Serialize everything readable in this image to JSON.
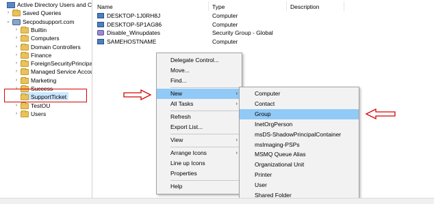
{
  "tree": {
    "items": [
      {
        "label": "Active Directory Users and Com",
        "icon": "root-icon",
        "level": 0,
        "expander": ""
      },
      {
        "label": "Saved Queries",
        "icon": "folder-icon",
        "level": 1,
        "expander": "›"
      },
      {
        "label": "Secpodsupport.com",
        "icon": "domain-icon",
        "level": 1,
        "expander": "⌄"
      },
      {
        "label": "Builtin",
        "icon": "folder-icon",
        "level": 2,
        "expander": "›"
      },
      {
        "label": "Computers",
        "icon": "folder-icon",
        "level": 2,
        "expander": "›"
      },
      {
        "label": "Domain Controllers",
        "icon": "folder-icon",
        "level": 2,
        "expander": "›"
      },
      {
        "label": "Finance",
        "icon": "folder-icon",
        "level": 2,
        "expander": "›"
      },
      {
        "label": "ForeignSecurityPrincipals",
        "icon": "folder-icon",
        "level": 2,
        "expander": "›"
      },
      {
        "label": "Managed Service Accour",
        "icon": "folder-icon",
        "level": 2,
        "expander": "›"
      },
      {
        "label": "Marketing",
        "icon": "folder-icon",
        "level": 2,
        "expander": "›"
      },
      {
        "label": "Success",
        "icon": "folder-icon",
        "level": 2,
        "expander": "›"
      },
      {
        "label": "SupportTicket",
        "icon": "folder-icon",
        "level": 2,
        "expander": "",
        "selected": true
      },
      {
        "label": "TestOU",
        "icon": "folder-icon",
        "level": 2,
        "expander": "›"
      },
      {
        "label": "Users",
        "icon": "folder-icon",
        "level": 2,
        "expander": "›"
      }
    ]
  },
  "list": {
    "columns": [
      "Name",
      "Type",
      "Description"
    ],
    "rows": [
      {
        "name": "DESKTOP-1J0RH8J",
        "type": "Computer",
        "icon": "computer-icon"
      },
      {
        "name": "DESKTOP-5P1AG86",
        "type": "Computer",
        "icon": "computer-icon"
      },
      {
        "name": "Disable_Winupdates",
        "type": "Security Group - Global",
        "icon": "group-icon"
      },
      {
        "name": "SAMEHOSTNAME",
        "type": "Computer",
        "icon": "computer-icon"
      }
    ]
  },
  "context_menu": {
    "items": [
      {
        "label": "Delegate Control...",
        "has_submenu": false
      },
      {
        "label": "Move...",
        "has_submenu": false
      },
      {
        "label": "Find...",
        "has_submenu": false
      },
      {
        "label": "New",
        "has_submenu": true,
        "highlighted": true
      },
      {
        "label": "All Tasks",
        "has_submenu": true
      },
      {
        "label": "Refresh",
        "has_submenu": false
      },
      {
        "label": "Export List...",
        "has_submenu": false
      },
      {
        "label": "View",
        "has_submenu": true
      },
      {
        "label": "Arrange Icons",
        "has_submenu": true
      },
      {
        "label": "Line up Icons",
        "has_submenu": false
      },
      {
        "label": "Properties",
        "has_submenu": false
      },
      {
        "label": "Help",
        "has_submenu": false
      }
    ]
  },
  "submenu": {
    "items": [
      {
        "label": "Computer"
      },
      {
        "label": "Contact"
      },
      {
        "label": "Group",
        "highlighted": true
      },
      {
        "label": "InetOrgPerson"
      },
      {
        "label": "msDS-ShadowPrincipalContainer"
      },
      {
        "label": "msImaging-PSPs"
      },
      {
        "label": "MSMQ Queue Alias"
      },
      {
        "label": "Organizational Unit"
      },
      {
        "label": "Printer"
      },
      {
        "label": "User"
      },
      {
        "label": "Shared Folder"
      }
    ]
  },
  "colors": {
    "highlight": "#91c9f7",
    "selection": "#cce8ff",
    "annotation": "#d40000"
  },
  "submenu_arrow_glyph": "›"
}
